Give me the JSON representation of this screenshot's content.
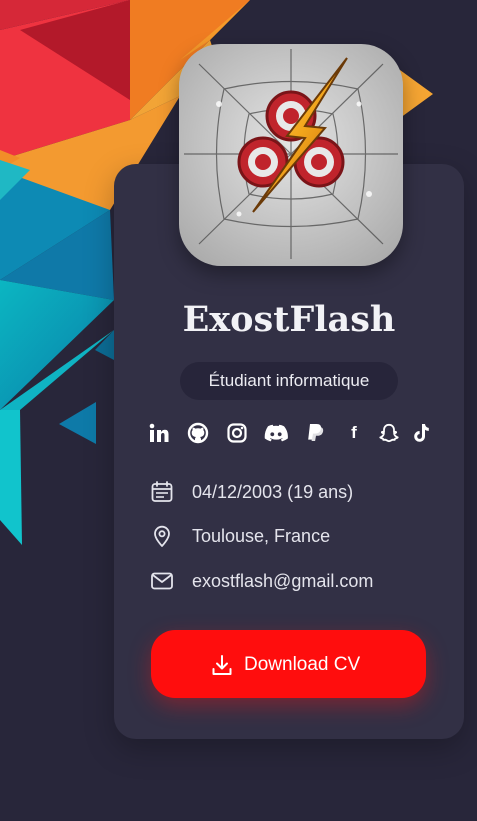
{
  "profile": {
    "name": "ExostFlash",
    "title": "Étudiant informatique",
    "avatar_icon": "lightning-spiderweb-logo"
  },
  "socials": [
    {
      "name": "linkedin",
      "glyph": "in"
    },
    {
      "name": "github"
    },
    {
      "name": "instagram"
    },
    {
      "name": "discord"
    },
    {
      "name": "paypal"
    },
    {
      "name": "facebook",
      "glyph": "f"
    },
    {
      "name": "snapchat"
    },
    {
      "name": "tiktok"
    }
  ],
  "info": {
    "birthdate": "04/12/2003 (19 ans)",
    "location": "Toulouse, France",
    "email": "exostflash@gmail.com"
  },
  "cta": {
    "download_label": "Download CV"
  },
  "colors": {
    "background": "#28263a",
    "card": "#323045",
    "badge": "#27253a",
    "accent": "#ff0d0d"
  }
}
